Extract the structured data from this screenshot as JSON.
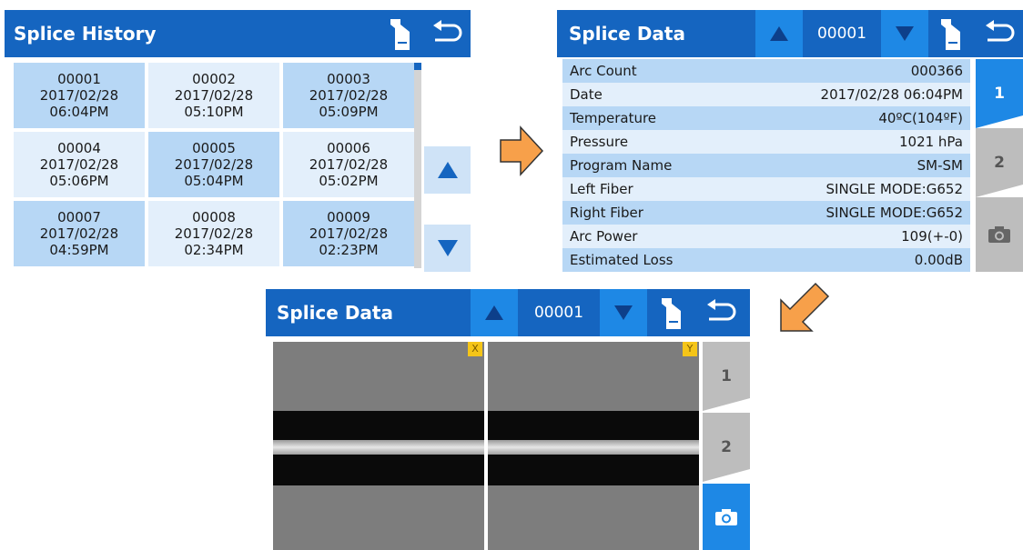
{
  "history_screen": {
    "title": "Splice History",
    "icons": [
      "fiber-holder-icon",
      "back-icon"
    ],
    "records": [
      {
        "id": "00001",
        "date": "2017/02/28",
        "time": "06:04PM"
      },
      {
        "id": "00002",
        "date": "2017/02/28",
        "time": "05:10PM"
      },
      {
        "id": "00003",
        "date": "2017/02/28",
        "time": "05:09PM"
      },
      {
        "id": "00004",
        "date": "2017/02/28",
        "time": "05:06PM"
      },
      {
        "id": "00005",
        "date": "2017/02/28",
        "time": "05:04PM"
      },
      {
        "id": "00006",
        "date": "2017/02/28",
        "time": "05:02PM"
      },
      {
        "id": "00007",
        "date": "2017/02/28",
        "time": "04:59PM"
      },
      {
        "id": "00008",
        "date": "2017/02/28",
        "time": "02:34PM"
      },
      {
        "id": "00009",
        "date": "2017/02/28",
        "time": "02:23PM"
      }
    ],
    "side_icons": [
      "up-arrow-icon",
      "down-arrow-icon"
    ]
  },
  "data_screen": {
    "title": "Splice Data",
    "record_number": "00001",
    "rows": [
      {
        "label": "Arc Count",
        "value": "000366"
      },
      {
        "label": "Date",
        "value": "2017/02/28 06:04PM"
      },
      {
        "label": "Temperature",
        "value": "40ºC(104ºF)"
      },
      {
        "label": "Pressure",
        "value": "1021 hPa"
      },
      {
        "label": "Program Name",
        "value": "SM-SM"
      },
      {
        "label": "Left Fiber",
        "value": "SINGLE MODE:G652"
      },
      {
        "label": "Right Fiber",
        "value": "SINGLE MODE:G652"
      },
      {
        "label": "Arc Power",
        "value": "109(+-0)"
      },
      {
        "label": "Estimated Loss",
        "value": "0.00dB"
      }
    ],
    "tabs": [
      "1",
      "2"
    ]
  },
  "image_screen": {
    "title": "Splice Data",
    "record_number": "00001",
    "tabs": [
      "1",
      "2"
    ],
    "axis_x": "X",
    "axis_y": "Y"
  },
  "colors": {
    "bar": "#1565c0",
    "accent": "#1e88e5",
    "row_dark": "#b7d7f5",
    "row_light": "#e3effb",
    "flow_arrow": "#f7a04a"
  }
}
